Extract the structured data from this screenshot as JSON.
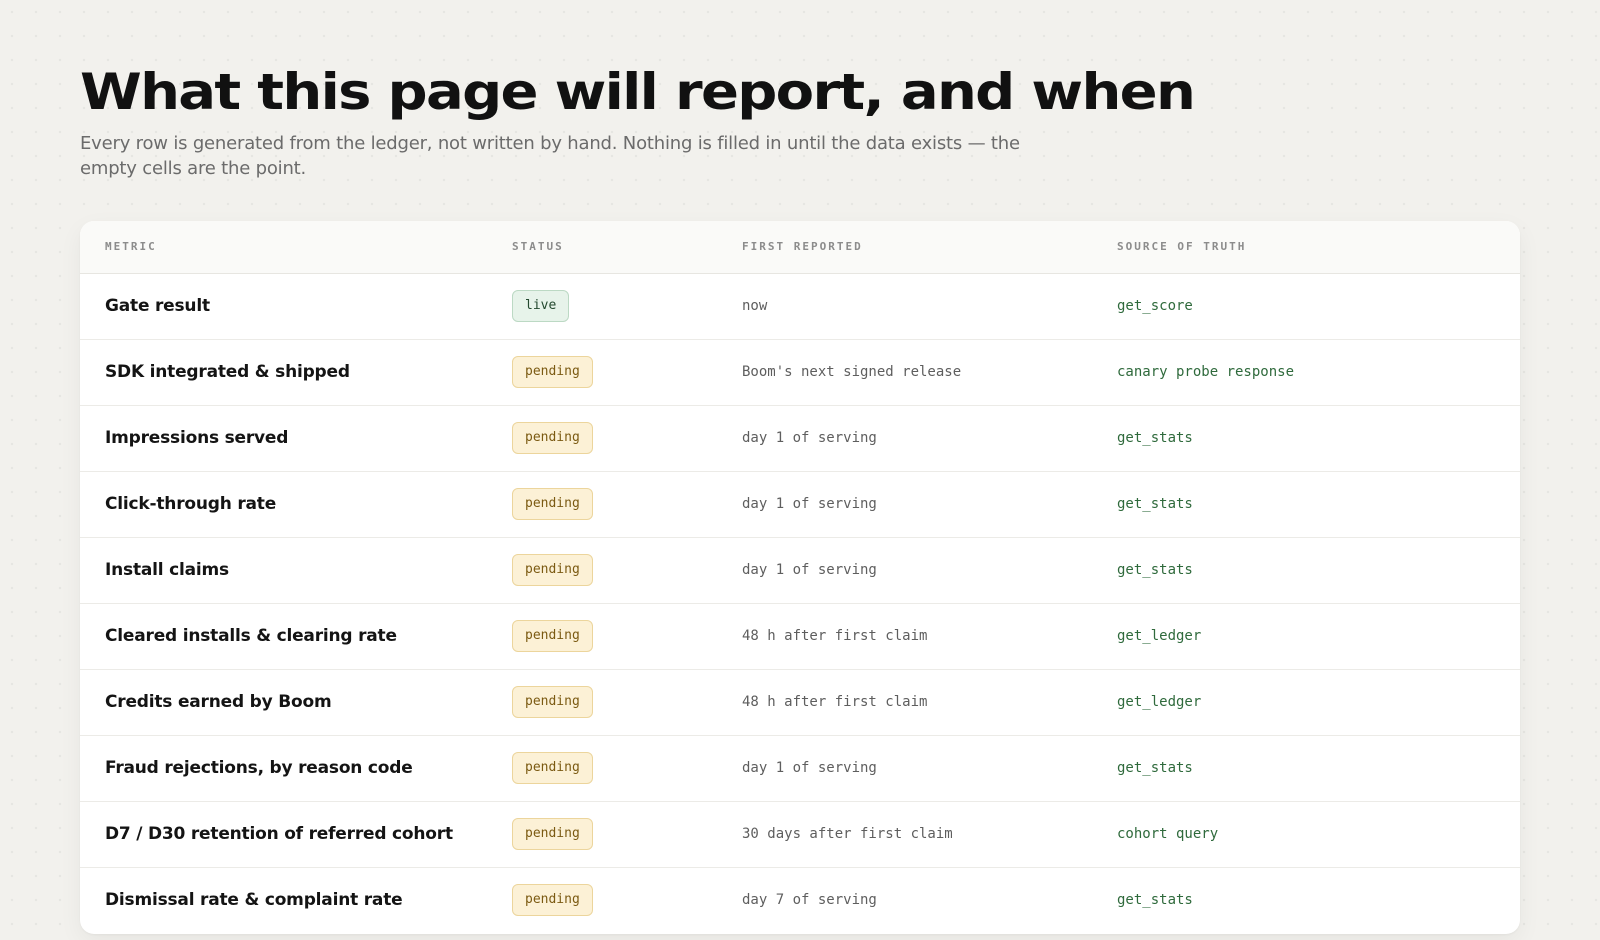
{
  "page": {
    "title": "What this page will report, and when",
    "subtitle": "Every row is generated from the ledger, not written by hand. Nothing is filled in until the data exists — the empty cells are the point."
  },
  "table": {
    "headers": {
      "metric": "METRIC",
      "status": "STATUS",
      "first_reported": "FIRST REPORTED",
      "source": "SOURCE OF TRUTH"
    },
    "rows": [
      {
        "metric": "Gate result",
        "status": "live",
        "first_reported": "now",
        "source": "get_score"
      },
      {
        "metric": "SDK integrated & shipped",
        "status": "pending",
        "first_reported": "Boom's next signed release",
        "source": "canary probe response"
      },
      {
        "metric": "Impressions served",
        "status": "pending",
        "first_reported": "day 1 of serving",
        "source": "get_stats"
      },
      {
        "metric": "Click-through rate",
        "status": "pending",
        "first_reported": "day 1 of serving",
        "source": "get_stats"
      },
      {
        "metric": "Install claims",
        "status": "pending",
        "first_reported": "day 1 of serving",
        "source": "get_stats"
      },
      {
        "metric": "Cleared installs & clearing rate",
        "status": "pending",
        "first_reported": "48 h after first claim",
        "source": "get_ledger"
      },
      {
        "metric": "Credits earned by Boom",
        "status": "pending",
        "first_reported": "48 h after first claim",
        "source": "get_ledger"
      },
      {
        "metric": "Fraud rejections, by reason code",
        "status": "pending",
        "first_reported": "day 1 of serving",
        "source": "get_stats"
      },
      {
        "metric": "D7 / D30 retention of referred cohort",
        "status": "pending",
        "first_reported": "30 days after first claim",
        "source": "cohort query"
      },
      {
        "metric": "Dismissal rate & complaint rate",
        "status": "pending",
        "first_reported": "day 7 of serving",
        "source": "get_stats"
      }
    ]
  },
  "colors": {
    "background": "#f2f1ed",
    "live_badge_bg": "#e7f3ea",
    "live_badge_text": "#24492f",
    "pending_badge_bg": "#fcf1d6",
    "pending_badge_text": "#7b5a12",
    "source_text": "#2f6a3c"
  }
}
